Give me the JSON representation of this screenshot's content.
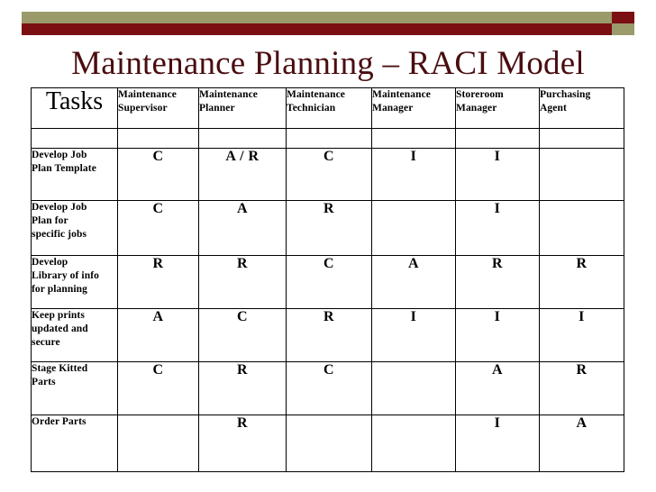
{
  "theme": {
    "accent_olive": "#9a9a6a",
    "accent_maroon": "#7b0f12",
    "title_color": "#4a0d10",
    "border_color": "#000000",
    "background": "#ffffff"
  },
  "title": "Maintenance Planning – RACI Model",
  "table": {
    "corner_label": "Tasks",
    "columns": [
      {
        "line1": "Maintenance",
        "line2": "Supervisor"
      },
      {
        "line1": "Maintenance",
        "line2": "Planner"
      },
      {
        "line1": "Maintenance",
        "line2": "Technician"
      },
      {
        "line1": "Maintenance",
        "line2": "Manager"
      },
      {
        "line1": "Storeroom",
        "line2": "Manager"
      },
      {
        "line1": "Purchasing",
        "line2": "Agent"
      }
    ],
    "rows": [
      {
        "task_lines": [
          "Develop Job",
          "Plan Template"
        ],
        "values": [
          "C",
          "A / R",
          "C",
          "I",
          "I",
          ""
        ]
      },
      {
        "task_lines": [
          "Develop Job",
          "Plan for",
          "specific jobs"
        ],
        "values": [
          "C",
          "A",
          "R",
          "",
          "I",
          ""
        ]
      },
      {
        "task_lines": [
          "Develop",
          "Library of info",
          "for planning"
        ],
        "values": [
          "R",
          "R",
          "C",
          "A",
          "R",
          "R"
        ]
      },
      {
        "task_lines": [
          "Keep prints",
          "updated and",
          "secure"
        ],
        "values": [
          "A",
          "C",
          "R",
          "I",
          "I",
          "I"
        ]
      },
      {
        "task_lines": [
          "Stage Kitted",
          "Parts"
        ],
        "values": [
          "C",
          "R",
          "C",
          "",
          "A",
          "R"
        ]
      },
      {
        "task_lines": [
          "Order Parts"
        ],
        "values": [
          "",
          "R",
          "",
          "",
          "I",
          "A"
        ]
      }
    ]
  }
}
